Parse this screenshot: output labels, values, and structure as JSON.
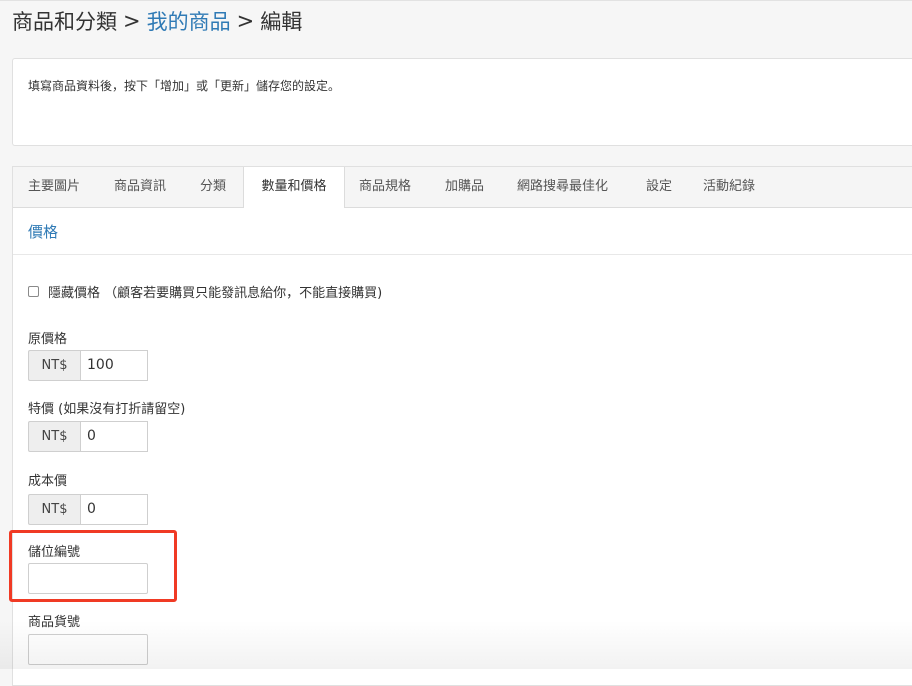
{
  "breadcrumb": {
    "root": "商品和分類",
    "separator": ">",
    "link": "我的商品",
    "current": "編輯"
  },
  "info": {
    "text": "填寫商品資料後，按下「增加」或「更新」儲存您的設定。"
  },
  "tabs": [
    {
      "label": "主要圖片"
    },
    {
      "label": "商品資訊"
    },
    {
      "label": "分類"
    },
    {
      "label": "數量和價格",
      "active": true
    },
    {
      "label": "商品規格"
    },
    {
      "label": "加購品"
    },
    {
      "label": "網路搜尋最佳化"
    },
    {
      "label": "設定"
    },
    {
      "label": "活動紀錄"
    }
  ],
  "section": {
    "title": "價格",
    "hide_price": {
      "label": "隱藏價格 （顧客若要購買只能發訊息給你，不能直接購買)",
      "checked": false
    }
  },
  "fields": {
    "original_price": {
      "label": "原價格",
      "currency": "NT$",
      "value": "100"
    },
    "special_price": {
      "label": "特價 (如果沒有打折請留空)",
      "currency": "NT$",
      "value": "0"
    },
    "cost_price": {
      "label": "成本價",
      "currency": "NT$",
      "value": "0"
    },
    "storage_code": {
      "label": "儲位編號",
      "value": ""
    },
    "product_code": {
      "label": "商品貨號",
      "value": ""
    }
  },
  "colors": {
    "accent": "#2f7ab5",
    "highlight": "#f03a24"
  }
}
